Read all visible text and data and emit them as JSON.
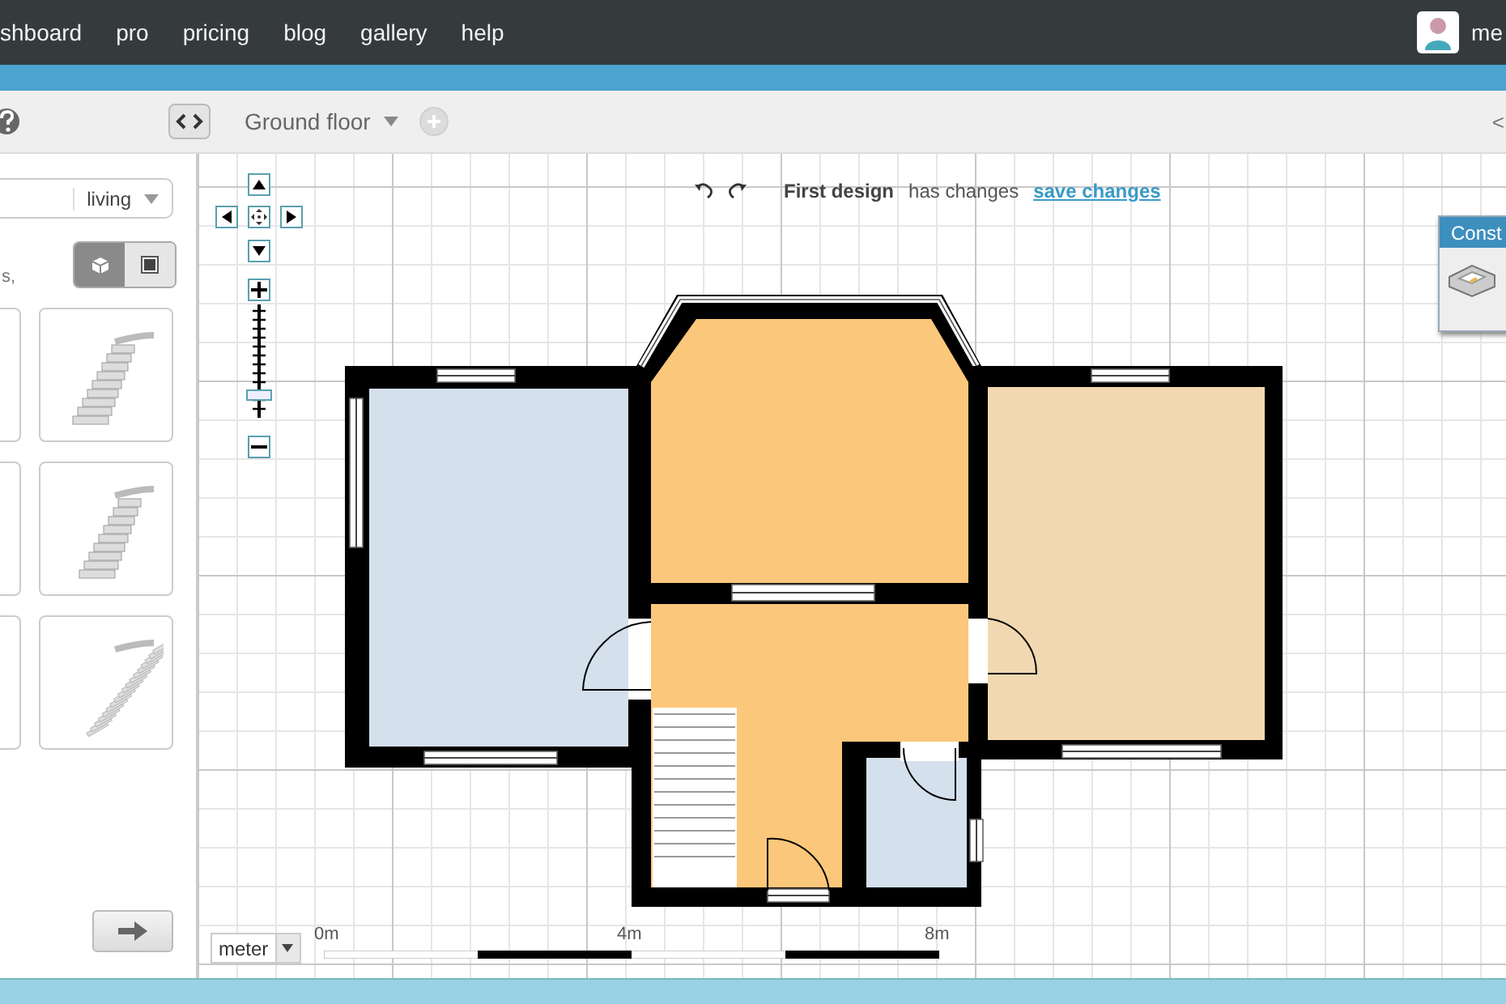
{
  "nav": {
    "items": [
      "shboard",
      "pro",
      "pricing",
      "blog",
      "gallery",
      "help"
    ],
    "user": "me"
  },
  "toolbar": {
    "floor": "Ground floor",
    "right_label": "<"
  },
  "library": {
    "category": "living",
    "hint": "s,",
    "view_modes": [
      {
        "selected": true
      },
      {
        "selected": false
      }
    ]
  },
  "zoom": {
    "level": 0.2
  },
  "design": {
    "name": "First design",
    "status": "has changes",
    "link": "save changes"
  },
  "scale": {
    "unit": "meter",
    "labels": [
      "0m",
      "4m",
      "8m"
    ]
  },
  "construct_panel": {
    "title": "Const"
  }
}
